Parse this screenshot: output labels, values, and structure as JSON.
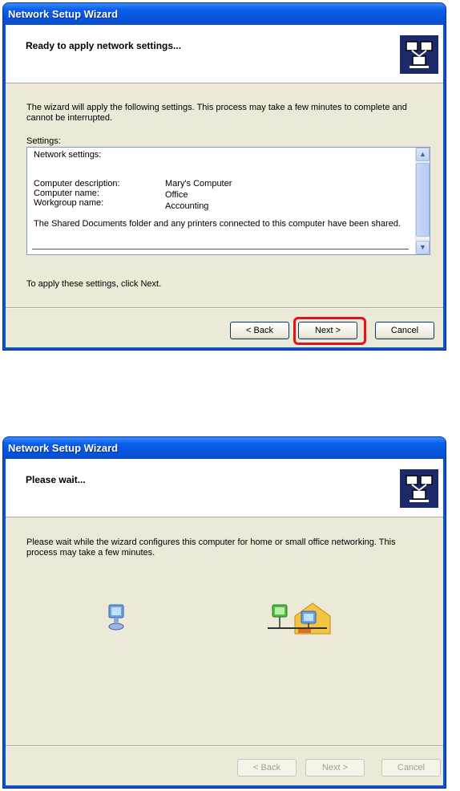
{
  "window1": {
    "title": "Network Setup Wizard",
    "header_title": "Ready to apply network settings...",
    "intro": "The wizard will apply the following settings. This process may take a few minutes to complete and cannot be interrupted.",
    "settings_label": "Settings:",
    "list": {
      "heading": "Network settings:",
      "rows": [
        {
          "label": "Computer description:",
          "value": "Mary's Computer"
        },
        {
          "label": "Computer name:",
          "value": "Office"
        },
        {
          "label": "Workgroup name:",
          "value": "Accounting"
        }
      ],
      "shared_note": "The Shared Documents folder and any printers connected to this computer have been shared."
    },
    "instruction": "To apply these settings, click Next.",
    "buttons": {
      "back": "< Back",
      "next": "Next >",
      "cancel": "Cancel"
    },
    "highlight_color": "#e4111a"
  },
  "window2": {
    "title": "Network Setup Wizard",
    "header_title": "Please wait...",
    "message": "Please wait while the wizard configures this computer for home or small office networking. This process may take a few minutes.",
    "buttons": {
      "back": "< Back",
      "next": "Next >",
      "cancel": "Cancel"
    },
    "buttons_disabled": true
  },
  "icons": {
    "header": "network-wizard-icon",
    "computer": "computer-icon",
    "network": "home-network-icon"
  },
  "colors": {
    "titlebar": "#0a5ee8",
    "dialog_bg": "#ece9d8",
    "header_bg": "#ffffff"
  }
}
